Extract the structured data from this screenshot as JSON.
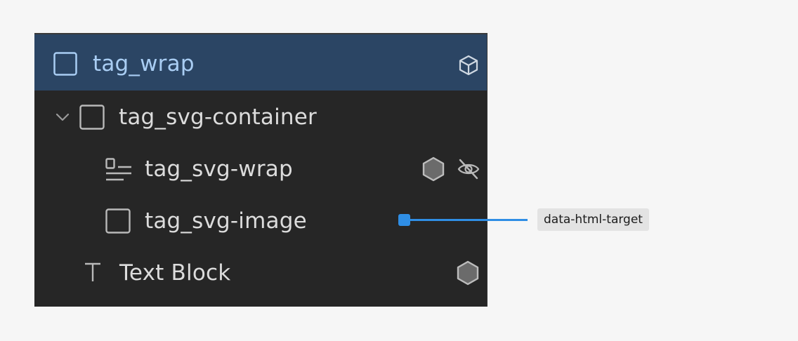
{
  "navigator": {
    "rows": [
      {
        "label": "tag_wrap",
        "selected": true,
        "icon": "box-outline-icon",
        "right_icons": [
          "component-cube-icon"
        ]
      },
      {
        "label": "tag_svg-container",
        "selected": false,
        "icon": "box-outline-icon",
        "expander": "chevron-down-icon",
        "right_icons": []
      },
      {
        "label": "tag_svg-wrap",
        "selected": false,
        "icon": "align-left-lines-icon",
        "right_icons": [
          "hexagon-filled-icon",
          "eye-off-icon"
        ]
      },
      {
        "label": "tag_svg-image",
        "selected": false,
        "icon": "box-outline-icon",
        "right_icons": []
      },
      {
        "label": "Text Block",
        "selected": false,
        "icon": "text-t-icon",
        "right_icons": [
          "hexagon-filled-icon"
        ]
      }
    ]
  },
  "annotation": {
    "label": "data-html-target",
    "color": "#2f8ee5"
  },
  "colors": {
    "panel_bg": "#262626",
    "selected_bg": "#2b4564",
    "selected_text": "#a9cdf3",
    "text": "#dcdcdc",
    "icon": "#b9b9b9"
  }
}
